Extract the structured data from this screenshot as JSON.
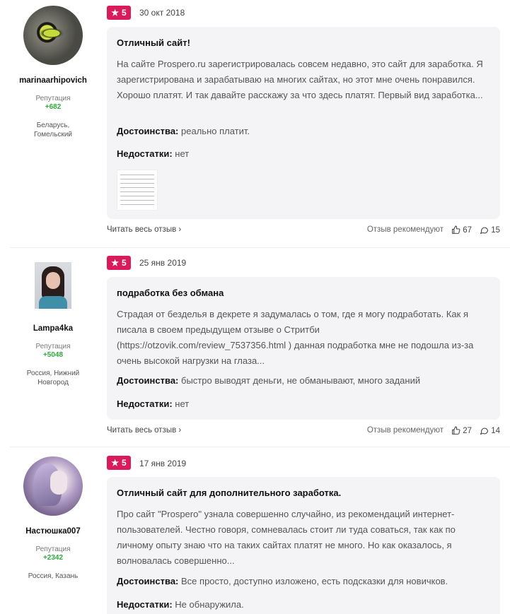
{
  "reviews": [
    {
      "username": "marinaarhipovich",
      "rep_label": "Репутация",
      "rep_value": "+682",
      "location": "Беларусь, Гомельский",
      "rating": "5",
      "date": "30 окт 2018",
      "title": "Отличный сайт!",
      "text": "На сайте Prospero.ru зарегистрировалась совсем недавно, это сайт для заработка. Я зарегистрирована и зарабатываю на многих сайтах, но этот мне очень понравился. Хорошо платят. И так давайте расскажу за что здесь платят. Первый вид заработка...",
      "pros_label": "Достоинства:",
      "pros": "реально платит.",
      "cons_label": "Недостатки:",
      "cons": "нет",
      "read_more": "Читать весь отзыв",
      "recommend": "Отзыв рекомендуют",
      "likes": "67",
      "comments": "15"
    },
    {
      "username": "Lampa4ka",
      "rep_label": "Репутация",
      "rep_value": "+5048",
      "location": "Россия, Нижний Новгород",
      "rating": "5",
      "date": "25 янв 2019",
      "title": "подработка без обмана",
      "text": "Страдая от безделья в декрете я задумалась о том, где я могу подработать. Как я писала в своем предыдущем отзыве о Стритби (https://otzovik.com/review_7537356.html ) данная подработка мне не подошла из-за очень высокой нагрузки на глаза...",
      "pros_label": "Достоинства:",
      "pros": "быстро выводят деньги, не обманывают, много заданий",
      "cons_label": "Недостатки:",
      "cons": "нет",
      "read_more": "Читать весь отзыв",
      "recommend": "Отзыв рекомендуют",
      "likes": "27",
      "comments": "14"
    },
    {
      "username": "Настюшка007",
      "rep_label": "Репутация",
      "rep_value": "+2342",
      "location": "Россия, Казань",
      "rating": "5",
      "date": "17 янв 2019",
      "title": "Отличный сайт для дополнительного заработка.",
      "text": "Про сайт \"Prospero\" узнала совершенно случайно, из рекомендаций интернет-пользователей. Честно говоря, сомневалась стоит ли туда соваться, так как по личному опыту знаю что на таких сайтах платят не много. Но как оказалось, я волновалась совершенно...",
      "pros_label": "Достоинства:",
      "pros": "Все просто, доступно изложено, есть подсказки для новичков.",
      "cons_label": "Недостатки:",
      "cons": "Не обнаружила."
    }
  ],
  "icons": {
    "star": "star-icon",
    "chevron": "chevron-right-icon",
    "like": "thumbs-up-icon",
    "comment": "comment-icon"
  },
  "colors": {
    "rating_badge": "#d91b5b",
    "reputation": "#2eaa3c",
    "card_bg": "#f4f4f6"
  }
}
